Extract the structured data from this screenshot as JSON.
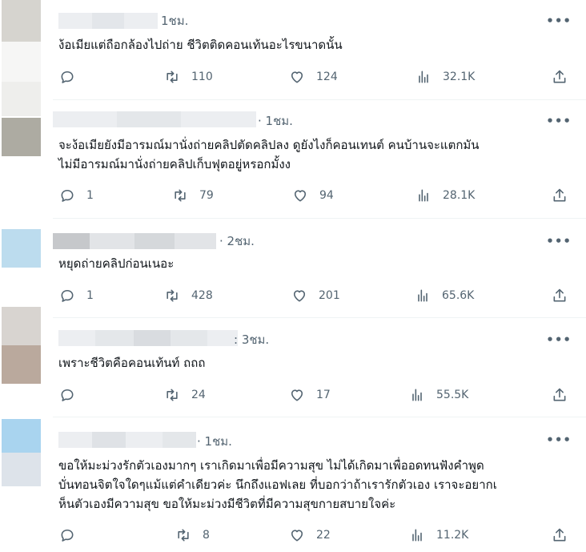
{
  "tweets": [
    {
      "time": "1ชม.",
      "lines": [
        "ง้อเมียแต่ถือกล้องไปถ่าย ชีวิตติดคอนเท้นอะไรขนาดนั้น"
      ],
      "replies": "",
      "retweets": "110",
      "likes": "124",
      "views": "32.1K"
    },
    {
      "time": "· 1ชม.",
      "lines": [
        "จะง้อเมียยังมีอารมณ์มานั่งถ่ายคลิปตัดคลิปลง ดูยังไงก็คอนเทนต์ คนบ้านจะแตกมัน",
        "ไม่มีอารมณ์มานั่งถ่ายคลิปเก็บฟุตอยู่หรอกมั้งง"
      ],
      "replies": "1",
      "retweets": "79",
      "likes": "94",
      "views": "28.1K"
    },
    {
      "time": "· 2ชม.",
      "lines": [
        "หยุดถ่ายคลิปก่อนเนอะ"
      ],
      "replies": "1",
      "retweets": "428",
      "likes": "201",
      "views": "65.6K"
    },
    {
      "time": ": 3ชม.",
      "lines": [
        "เพราะชีวิตคือคอนเท้นท์ ถถถ"
      ],
      "replies": "",
      "retweets": "24",
      "likes": "17",
      "views": "55.5K"
    },
    {
      "time": "· 1ชม.",
      "lines": [
        "ขอให้มะม่วงรักตัวเองมากๆ เราเกิดมาเพื่อมีความสุข ไม่ได้เกิดมาเพื่ออดทนฟังคำพูด",
        "บั่นทอนจิตใจใดๆแม้แต่คำเดียวค่ะ นึกถึงแอฟเลย ที่บอกว่าถ้าเรารักตัวเอง เราจะอยากเ",
        "ห็นตัวเองมีความสุข ขอให้มะม่วงมีชีวิตที่มีความสุขกายสบายใจค่ะ"
      ],
      "replies": "",
      "retweets": "8",
      "likes": "22",
      "views": "11.2K"
    }
  ],
  "icons": {
    "more": "more-dots-icon",
    "reply": "reply-icon",
    "retweet": "retweet-icon",
    "like": "heart-icon",
    "views": "views-chart-icon",
    "share": "share-icon"
  },
  "more_glyph": "•••"
}
